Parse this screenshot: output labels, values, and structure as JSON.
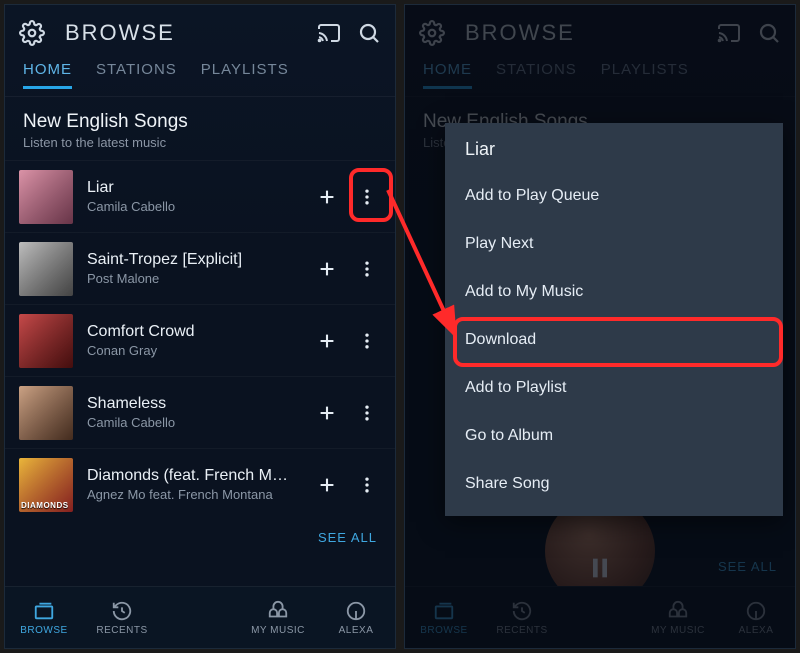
{
  "app": {
    "browse_title": "BROWSE"
  },
  "tabs": {
    "home": "HOME",
    "stations": "STATIONS",
    "playlists": "PLAYLISTS"
  },
  "section": {
    "title": "New English Songs",
    "subtitle": "Listen to the latest music",
    "see_all": "SEE ALL"
  },
  "songs": [
    {
      "title": "Liar",
      "artist": "Camila Cabello",
      "tint": "tint-pink",
      "tag": ""
    },
    {
      "title": "Saint-Tropez [Explicit]",
      "artist": "Post Malone",
      "tint": "tint-grey",
      "tag": ""
    },
    {
      "title": "Comfort Crowd",
      "artist": "Conan Gray",
      "tint": "tint-red",
      "tag": ""
    },
    {
      "title": "Shameless",
      "artist": "Camila Cabello",
      "tint": "tint-tan",
      "tag": ""
    },
    {
      "title": "Diamonds (feat. French Mont…",
      "artist": "Agnez Mo feat. French Montana",
      "tint": "tint-fire",
      "tag": "DIAMONDS"
    }
  ],
  "nav": {
    "browse": "BROWSE",
    "recents": "RECENTS",
    "mymusic": "MY MUSIC",
    "alexa": "ALEXA"
  },
  "menu": {
    "title": "Liar",
    "items": [
      "Add to Play Queue",
      "Play Next",
      "Add to My Music",
      "Download",
      "Add to Playlist",
      "Go to Album",
      "Share Song"
    ]
  },
  "highlight_color": "#ff2a2a"
}
